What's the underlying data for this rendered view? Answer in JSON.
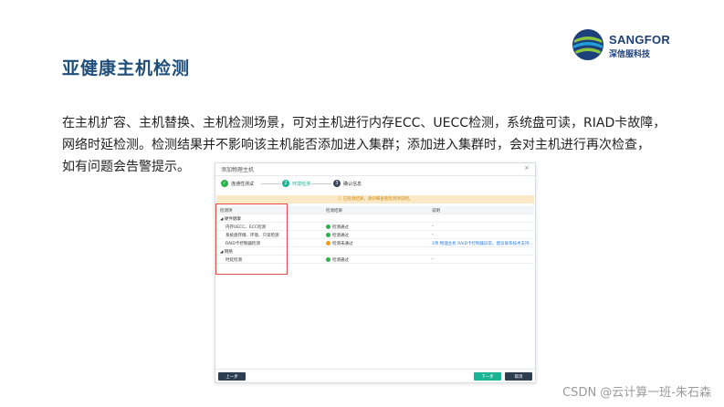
{
  "title": "亚健康主机检测",
  "logo": {
    "name": "SANGFOR",
    "sub": "深信服科技"
  },
  "body_lines": [
    "在主机扩容、主机替换、主机检测场景，可对主机进行内存ECC、UECC检测，系统盘可读，RIAD卡故障，",
    "网络时延检测。检测结果并不影响该主机能否添加进入集群；添加进入集群时，会对主机进行再次检查，",
    "如有问题会告警提示。"
  ],
  "dialog": {
    "title": "添加物理主机",
    "close": "×",
    "steps": [
      {
        "num": "✓",
        "label": "连通性测试"
      },
      {
        "num": "2",
        "label": "环境检测"
      },
      {
        "num": "3",
        "label": "确认信息"
      }
    ],
    "notice": "ⓘ 已检测结果，请仔细查看检测项说明。",
    "table_headers": [
      "检测项",
      "检测结果",
      "说明"
    ],
    "rows": [
      {
        "item": "◢ 硬件健康",
        "result": "",
        "status": "",
        "note": ""
      },
      {
        "item": "内存UECC、ECC检测",
        "result": "检测通过",
        "status": "ok",
        "note": "-"
      },
      {
        "item": "系统盘存储、环境、只读检测",
        "result": "检测通过",
        "status": "ok",
        "note": "-"
      },
      {
        "item": "RAID卡控制器检测",
        "result": "检测未通过",
        "status": "warn",
        "note": "1项 物理主机 RAID卡控制器异常，建议联系技术支持..."
      },
      {
        "item": "◢ 网络",
        "result": "",
        "status": "",
        "note": ""
      },
      {
        "item": "时延检测",
        "result": "检测通过",
        "status": "ok",
        "note": "-"
      }
    ],
    "buttons": {
      "prev": "上一步",
      "next": "下一步",
      "cancel": "取消"
    }
  },
  "watermark": "CSDN @云计算一班-朱石森",
  "colors": {
    "title": "#1f4e79",
    "accent_green": "#1ab394",
    "warning": "#f39c12",
    "highlight": "#e54b4b"
  }
}
